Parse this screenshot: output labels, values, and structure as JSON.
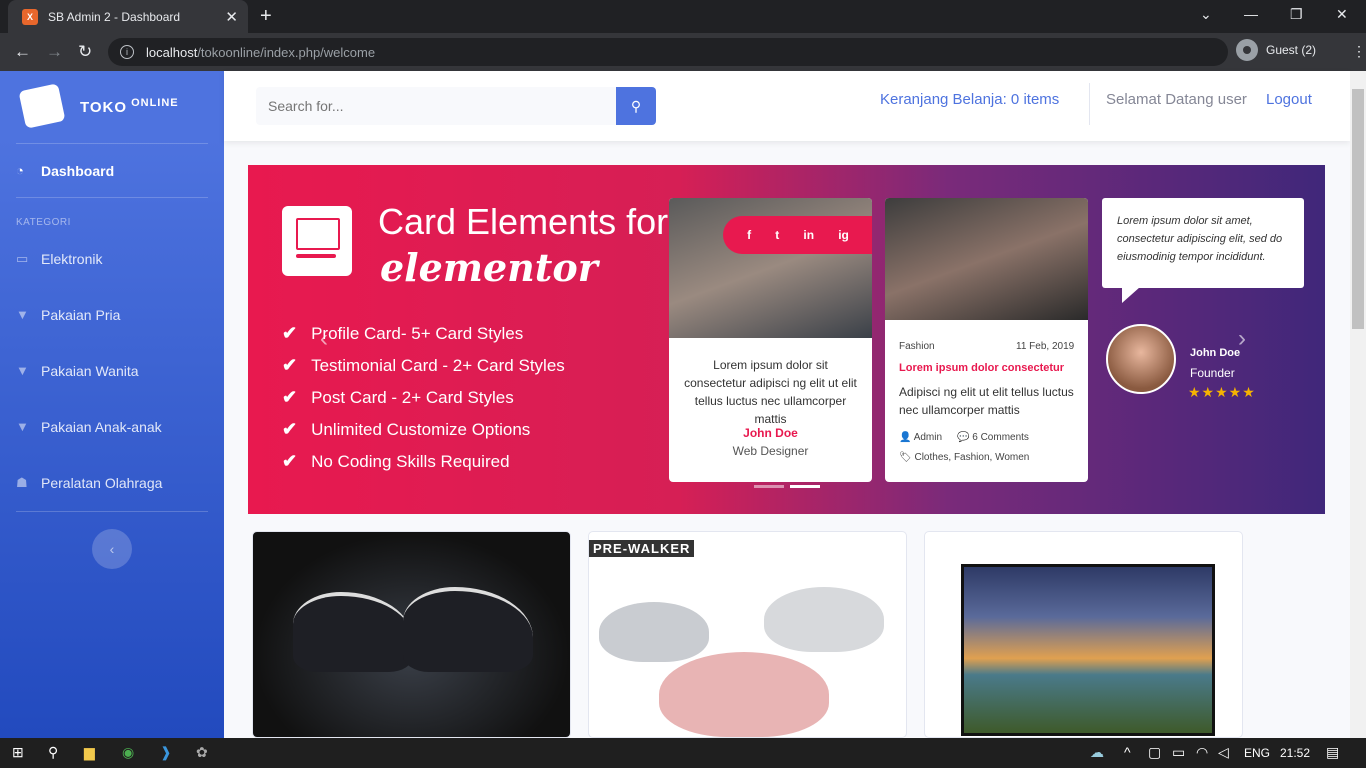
{
  "browser": {
    "tab_title": "SB Admin 2 - Dashboard",
    "tab_close": "✕",
    "new_tab": "+",
    "url_host": "localhost",
    "url_path": "/tokoonline/index.php/welcome",
    "profile": "Guest (2)"
  },
  "sidebar": {
    "brand_main": "TOKO",
    "brand_sup": "ONLINE",
    "dashboard": "Dashboard",
    "heading": "KATEGORI",
    "items": [
      {
        "label": "Elektronik",
        "icon": "monitor-icon"
      },
      {
        "label": "Pakaian Pria",
        "icon": "shirt-icon"
      },
      {
        "label": "Pakaian Wanita",
        "icon": "shirt-icon"
      },
      {
        "label": "Pakaian Anak-anak",
        "icon": "shirt-icon"
      },
      {
        "label": "Peralatan Olahraga",
        "icon": "running-icon"
      }
    ]
  },
  "topbar": {
    "search_placeholder": "Search for...",
    "cart": "Keranjang Belanja: 0 items",
    "welcome": "Selamat Datang user",
    "logout": "Logout"
  },
  "banner": {
    "title1": "Card Elements for",
    "title2": "elementor",
    "features": [
      "Profile Card- 5+ Card Styles",
      "Testimonial Card - 2+ Card Styles",
      "Post Card - 2+ Card Styles",
      "Unlimited Customize Options",
      "No Coding Skills Required"
    ],
    "card1": {
      "social": [
        "f",
        "t",
        "in",
        "ig"
      ],
      "text": "Lorem ipsum dolor sit consectetur adipisci ng elit ut elit tellus luctus nec ullamcorper mattis",
      "name": "John Doe",
      "role": "Web Designer"
    },
    "card2": {
      "category": "Fashion",
      "date": "11 Feb, 2019",
      "title": "Lorem ipsum dolor consectetur",
      "text": "Adipisci ng elit ut elit tellus luctus nec ullamcorper mattis",
      "author": "Admin",
      "comments": "6 Comments",
      "tags": "Clothes, Fashion, Women"
    },
    "testimonial": {
      "quote": "Lorem ipsum dolor sit amet, consectetur adipiscing elit, sed do eiusmodinig tempor incididunt.",
      "name": "John Doe",
      "role": "Founder",
      "stars": "★★★★★",
      "rating": 5
    }
  },
  "products": {
    "p2_label": "PRE-WALKER"
  },
  "taskbar": {
    "lang": "ENG",
    "time": "21:52"
  }
}
